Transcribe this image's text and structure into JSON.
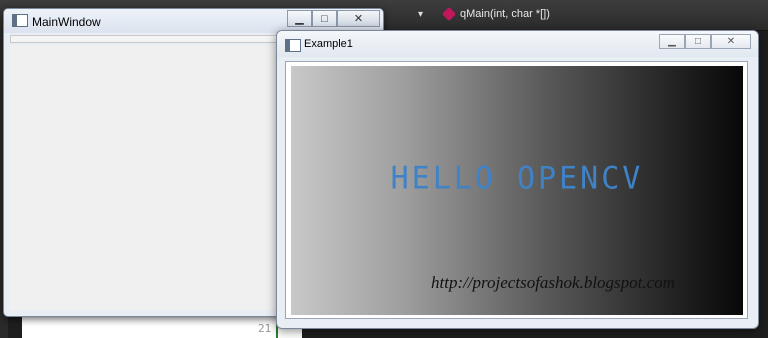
{
  "ide": {
    "dropdown_arrow": "▾",
    "current_function": "qMain(int, char *[])",
    "line_number": "21"
  },
  "main_window": {
    "title": "MainWindow",
    "controls": {
      "minimize": "▁",
      "maximize": "□",
      "close": "✕"
    }
  },
  "example_window": {
    "title": "Example1",
    "controls": {
      "minimize": "▁",
      "maximize": "□",
      "close": "✕"
    },
    "image": {
      "headline": "HELLO OPENCV",
      "watermark": "http://projectsofashok.blogspot.com"
    }
  },
  "colors": {
    "headline": "#3f82c6",
    "func_icon": "#c2185b"
  }
}
